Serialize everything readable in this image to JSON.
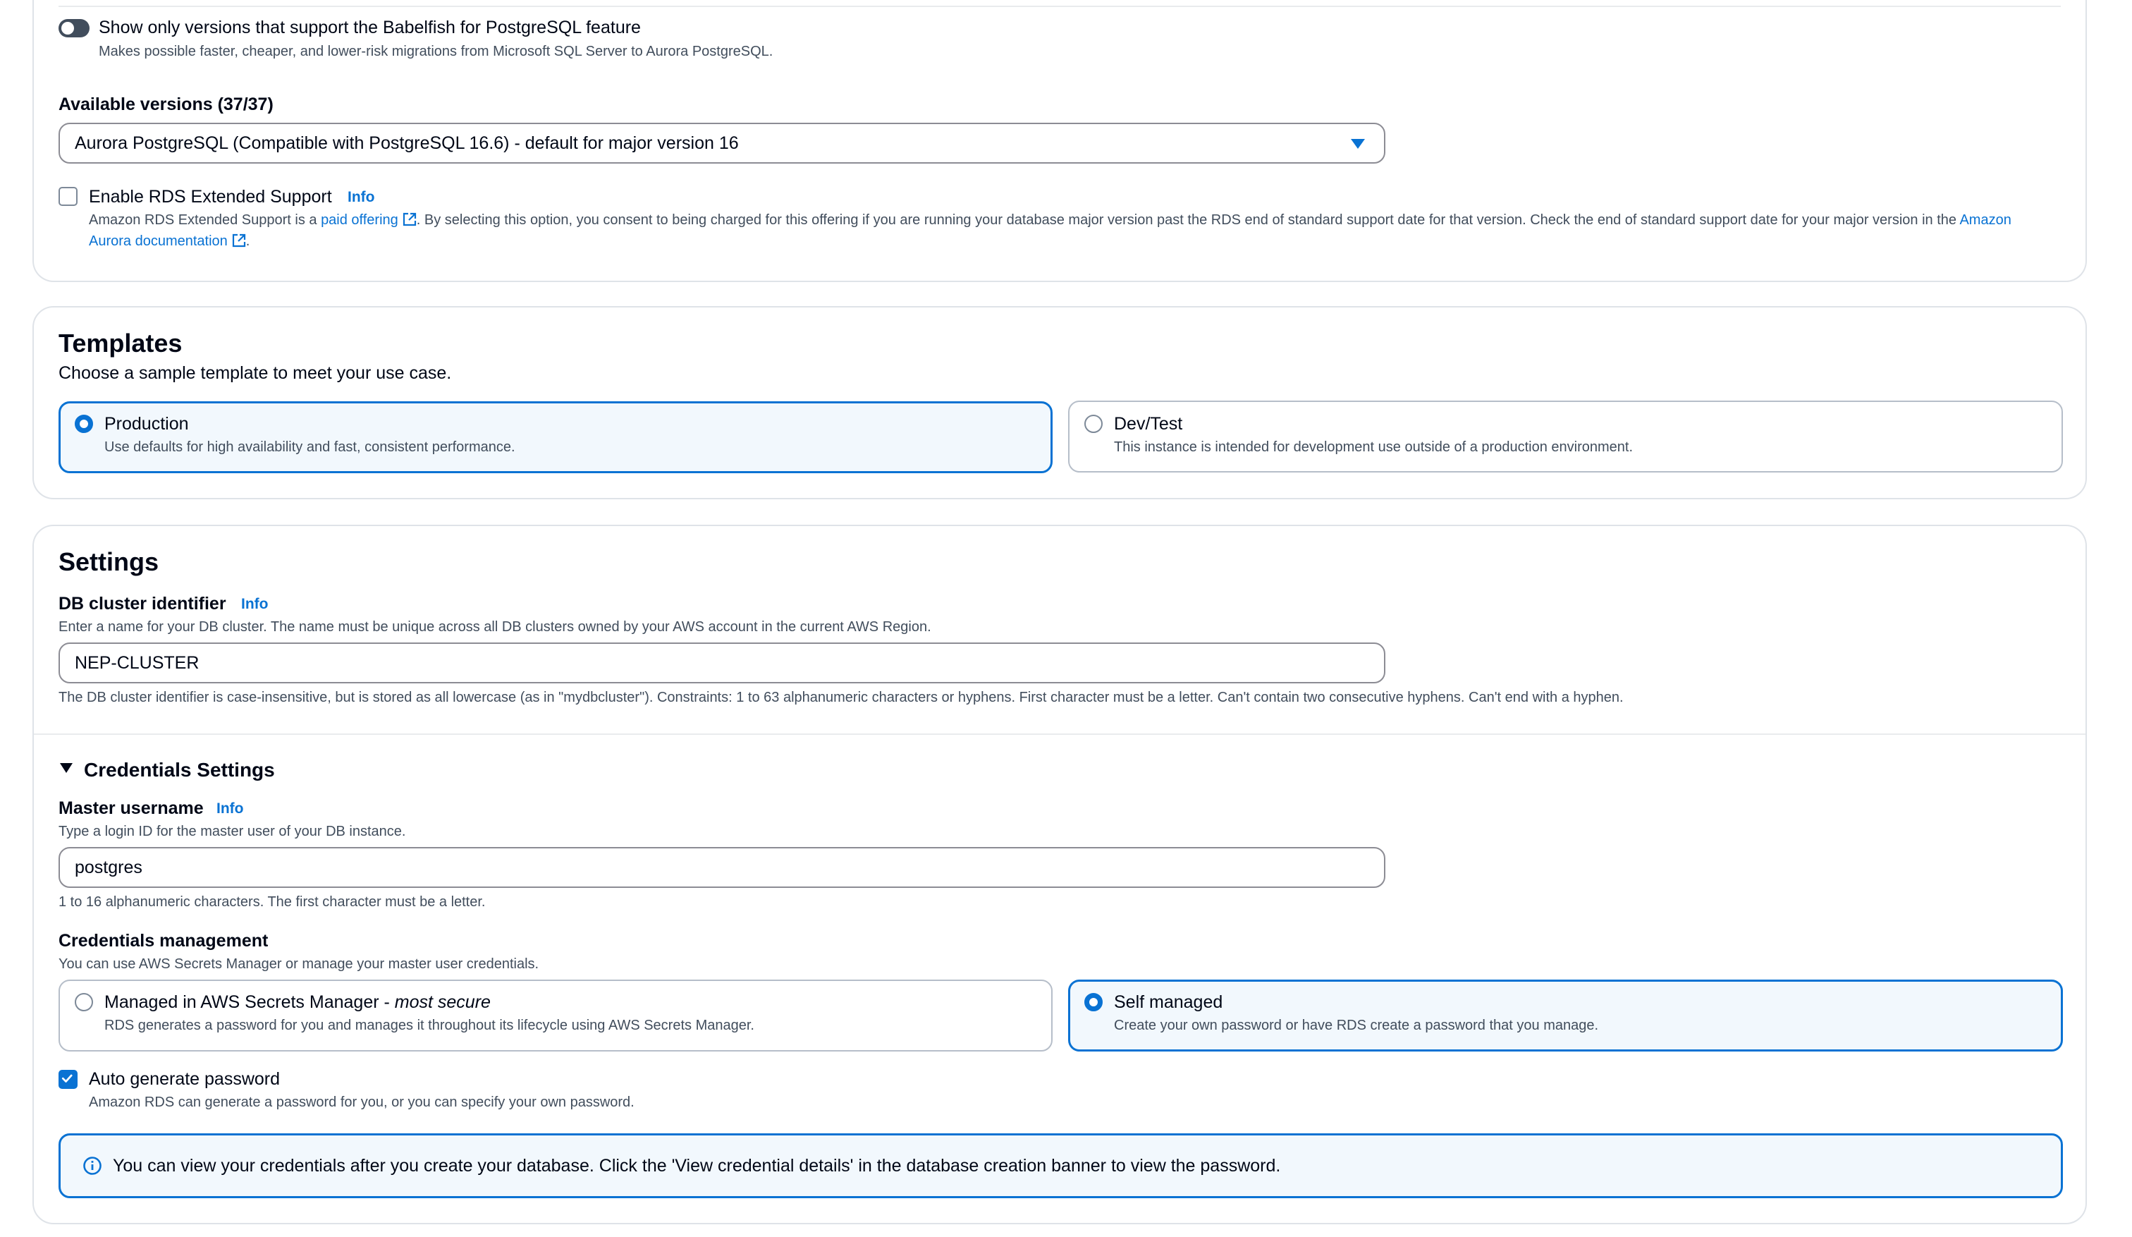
{
  "babelfish": {
    "label": "Show only versions that support the Babelfish for PostgreSQL feature",
    "description": "Makes possible faster, cheaper, and lower-risk migrations from Microsoft SQL Server to Aurora PostgreSQL."
  },
  "versions": {
    "label": "Available versions (37/37)",
    "selected": "Aurora PostgreSQL (Compatible with PostgreSQL 16.6) - default for major version 16"
  },
  "extended_support": {
    "label": "Enable RDS Extended Support",
    "info": "Info",
    "desc_part1": "Amazon RDS Extended Support is a ",
    "desc_link1": "paid offering",
    "desc_part2": ". By selecting this option, you consent to being charged for this offering if you are running your database major version past the RDS end of standard support date for that version. Check the end of standard support date for your major version in the ",
    "desc_link2": "Amazon Aurora documentation",
    "desc_part3": "."
  },
  "templates": {
    "title": "Templates",
    "description": "Choose a sample template to meet your use case.",
    "options": [
      {
        "label": "Production",
        "description": "Use defaults for high availability and fast, consistent performance."
      },
      {
        "label": "Dev/Test",
        "description": "This instance is intended for development use outside of a production environment."
      }
    ]
  },
  "settings": {
    "title": "Settings",
    "cluster_id": {
      "label": "DB cluster identifier",
      "info": "Info",
      "description": "Enter a name for your DB cluster. The name must be unique across all DB clusters owned by your AWS account in the current AWS Region.",
      "value": "NEP-CLUSTER",
      "constraint": "The DB cluster identifier is case-insensitive, but is stored as all lowercase (as in \"mydbcluster\"). Constraints: 1 to 63 alphanumeric characters or hyphens. First character must be a letter. Can't contain two consecutive hyphens. Can't end with a hyphen."
    },
    "credentials": {
      "title": "Credentials Settings",
      "master_username": {
        "label": "Master username",
        "info": "Info",
        "description": "Type a login ID for the master user of your DB instance.",
        "value": "postgres",
        "constraint": "1 to 16 alphanumeric characters. The first character must be a letter."
      },
      "management": {
        "label": "Credentials management",
        "description": "You can use AWS Secrets Manager or manage your master user credentials.",
        "managed_label": "Managed in AWS Secrets Manager - ",
        "managed_emph": "most secure",
        "managed_desc": "RDS generates a password for you and manages it throughout its lifecycle using AWS Secrets Manager.",
        "self_label": "Self managed",
        "self_desc": "Create your own password or have RDS create a password that you manage."
      },
      "auto_password": {
        "label": "Auto generate password",
        "description": "Amazon RDS can generate a password for you, or you can specify your own password."
      },
      "alert": "You can view your credentials after you create your database. Click the 'View credential details' in the database creation banner to view the password."
    }
  },
  "colors": {
    "accent": "#0972d3",
    "selected_bg": "#f2f8fd",
    "border": "#dfe3e8"
  }
}
